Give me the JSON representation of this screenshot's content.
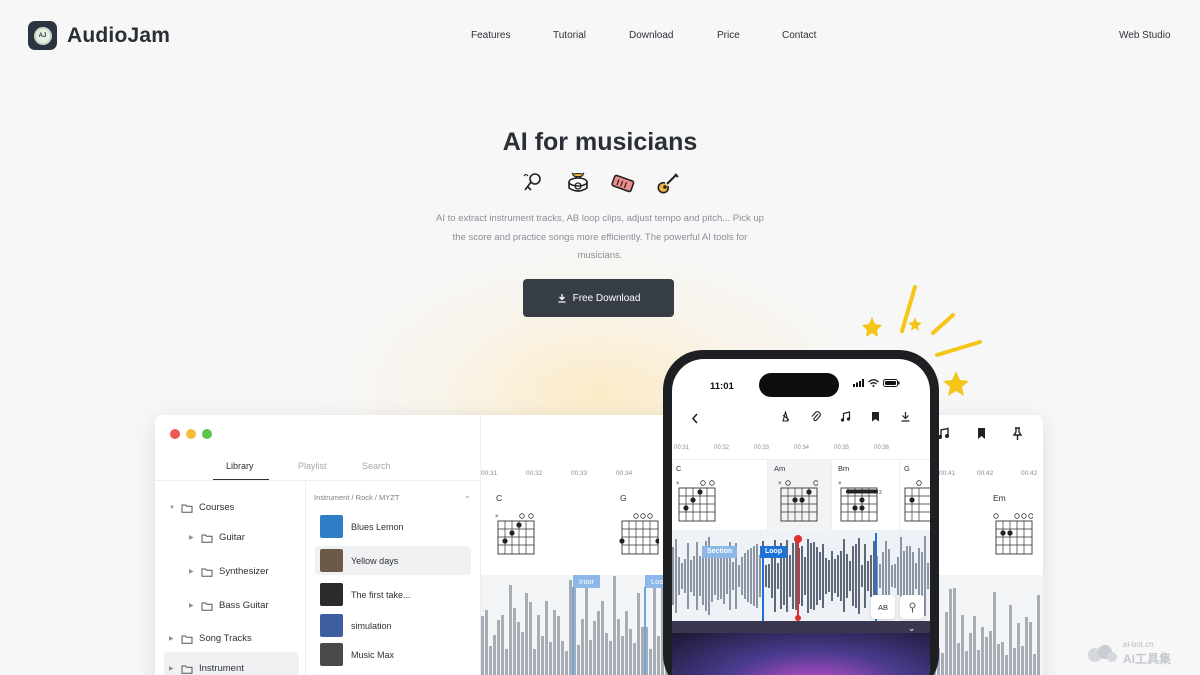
{
  "brand": {
    "name": "AudioJam",
    "logo_icon": "vinyl-disc-icon",
    "logo_glyph": "AJ"
  },
  "nav": {
    "features": "Features",
    "tutorial": "Tutorial",
    "download": "Download",
    "price": "Price",
    "contact": "Contact",
    "web_studio": "Web Studio"
  },
  "hero": {
    "title": "AI for musicians",
    "icons": [
      "microphone-icon",
      "drum-icon",
      "keyboard-icon",
      "guitar-icon"
    ],
    "description": "AI to extract instrument tracks, AB loop clips, adjust tempo and pitch... Pick up the score and practice songs more efficiently. The powerful AI tools for musicians.",
    "cta_label": "Free Download",
    "cta_icon": "download-icon"
  },
  "desktop": {
    "tabs": {
      "library": "Library",
      "playlist": "Playlist",
      "search": "Search"
    },
    "tree": {
      "courses": "Courses",
      "guitar": "Guitar",
      "synthesizer": "Synthesizer",
      "bass_guitar": "Bass Guitar",
      "song_tracks": "Song Tracks",
      "instrument": "Instrument"
    },
    "breadcrumb": "Instrument / Rock / MYZT",
    "songs": [
      {
        "title": "Blues Lemon",
        "color": "#2e7fc8"
      },
      {
        "title": "Yellow days",
        "color": "#6b5a4a"
      },
      {
        "title": "The first take...",
        "color": "#2b2b2b"
      },
      {
        "title": "simulation",
        "color": "#3d5fa0"
      },
      {
        "title": "Music Max",
        "color": "#4a4a4a"
      }
    ],
    "timeline": [
      "00:31",
      "00:32",
      "00:33",
      "00:34",
      "00:41",
      "00:42",
      "00:42"
    ],
    "chords": {
      "c": "C",
      "g": "G",
      "em": "Em"
    },
    "sections": {
      "intro": "Intor",
      "loop": "Loo"
    }
  },
  "phone": {
    "time": "11:01",
    "timeline": [
      "00:31",
      "00:32",
      "00:33",
      "00:34",
      "00:35",
      "00:36"
    ],
    "chords": {
      "c": "C",
      "am": "Am",
      "bm": "Bm",
      "g": "G"
    },
    "loop_label": "Loop",
    "section_label": "Section",
    "ab_label": "AB",
    "icons": [
      "back-icon",
      "metronome-icon",
      "clip-icon",
      "music-note-icon",
      "bookmark-icon",
      "download-icon"
    ]
  },
  "watermark": {
    "url": "ai-bot.cn",
    "cn": "AI工具集"
  },
  "colors": {
    "accent_dark": "#373d45",
    "loop_blue": "#1e73d8",
    "playhead_red": "#e0302e",
    "spark_yellow": "#f5c518"
  }
}
